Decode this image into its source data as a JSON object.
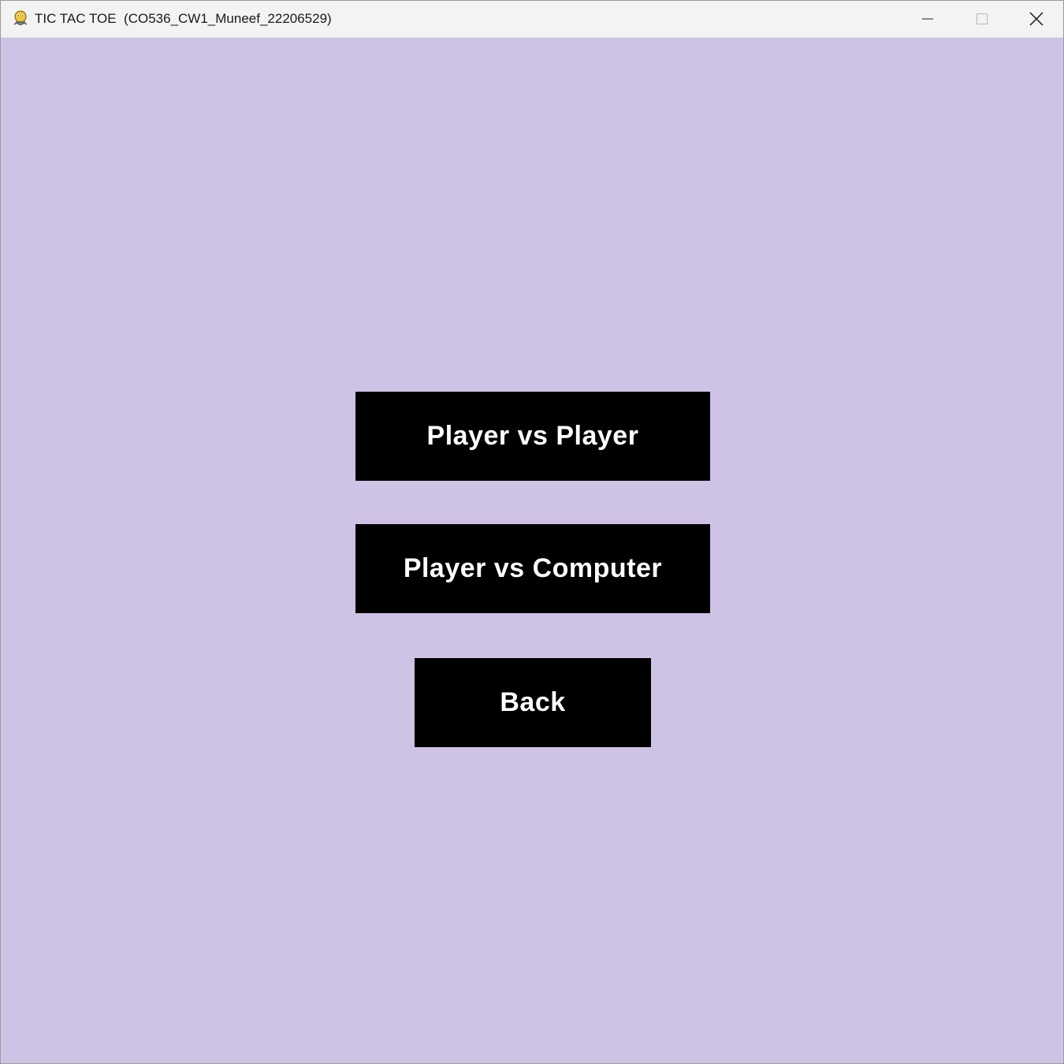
{
  "window": {
    "title": "TIC TAC TOE  (CO536_CW1_Muneef_22206529)",
    "app_icon": "pygame-snake-icon",
    "controls": {
      "minimize_icon": "minimize-icon",
      "maximize_icon": "maximize-icon",
      "close_icon": "close-icon"
    }
  },
  "menu": {
    "buttons": [
      {
        "label": "Player vs Player"
      },
      {
        "label": "Player vs Computer"
      },
      {
        "label": "Back"
      }
    ]
  },
  "colors": {
    "background": "#cec3e5",
    "button_fill": "#000000",
    "button_text": "#ffffff",
    "titlebar": "#f3f3f3"
  }
}
